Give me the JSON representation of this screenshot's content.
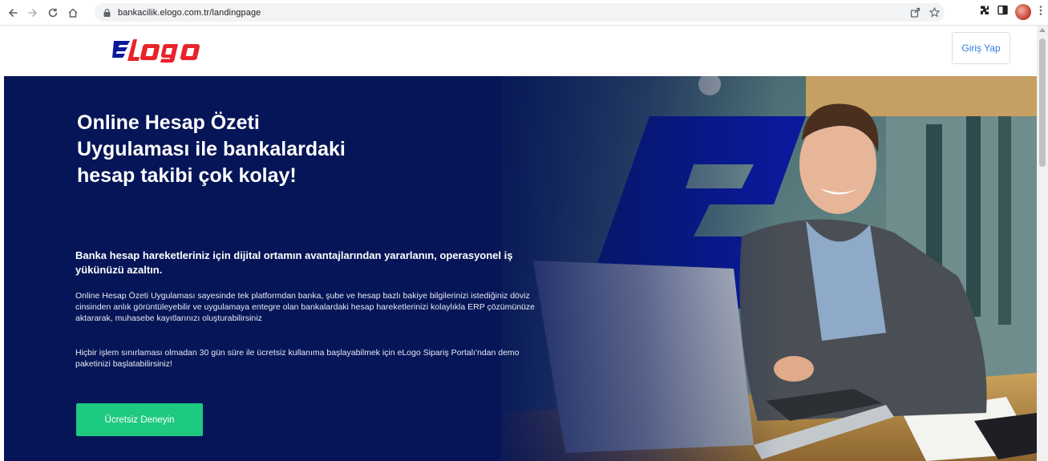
{
  "browser": {
    "url": "bankacilik.elogo.com.tr/landingpage"
  },
  "header": {
    "logo_text": "elogo",
    "login_label": "Giriş Yap"
  },
  "hero": {
    "headline_lines": [
      "Online Hesap Özeti",
      "Uygulaması ile bankalardaki",
      "hesap takibi çok kolay!"
    ],
    "lead": "Banka hesap hareketleriniz için dijital ortamın avantajlarından yararlanın, operasyonel iş yükünüzü azaltın.",
    "description": "Online Hesap Özeti Uygulaması sayesinde tek platformdan banka, şube ve hesap bazlı bakiye bilgilerinizi istediğiniz döviz cinsinden anlık görüntüleyebilir ve uygulamaya entegre olan bankalardaki hesap hareketlerinizi kolaylıkla ERP çözümünüze aktararak, muhasebe kayıtlarınızı oluşturabilirsiniz",
    "trial_text": "Hiçbir işlem sınırlaması olmadan 30 gün süre ile ücretsiz kullanıma başlayabilmek için eLogo Sipariş Portalı'ndan demo paketinizi başlatabilirsiniz!",
    "cta_label": "Ücretsiz Deneyin"
  },
  "colors": {
    "hero_bg": "#051557",
    "brand_red": "#e8232a",
    "brand_blue": "#0a1a9a",
    "cta_green": "#1ec980",
    "login_blue": "#2f7de1"
  },
  "icons": [
    "back-icon",
    "forward-icon",
    "reload-icon",
    "home-icon",
    "lock-icon",
    "share-icon",
    "star-icon",
    "extensions-icon",
    "sidepanel-icon",
    "profile-avatar",
    "menu-icon"
  ]
}
